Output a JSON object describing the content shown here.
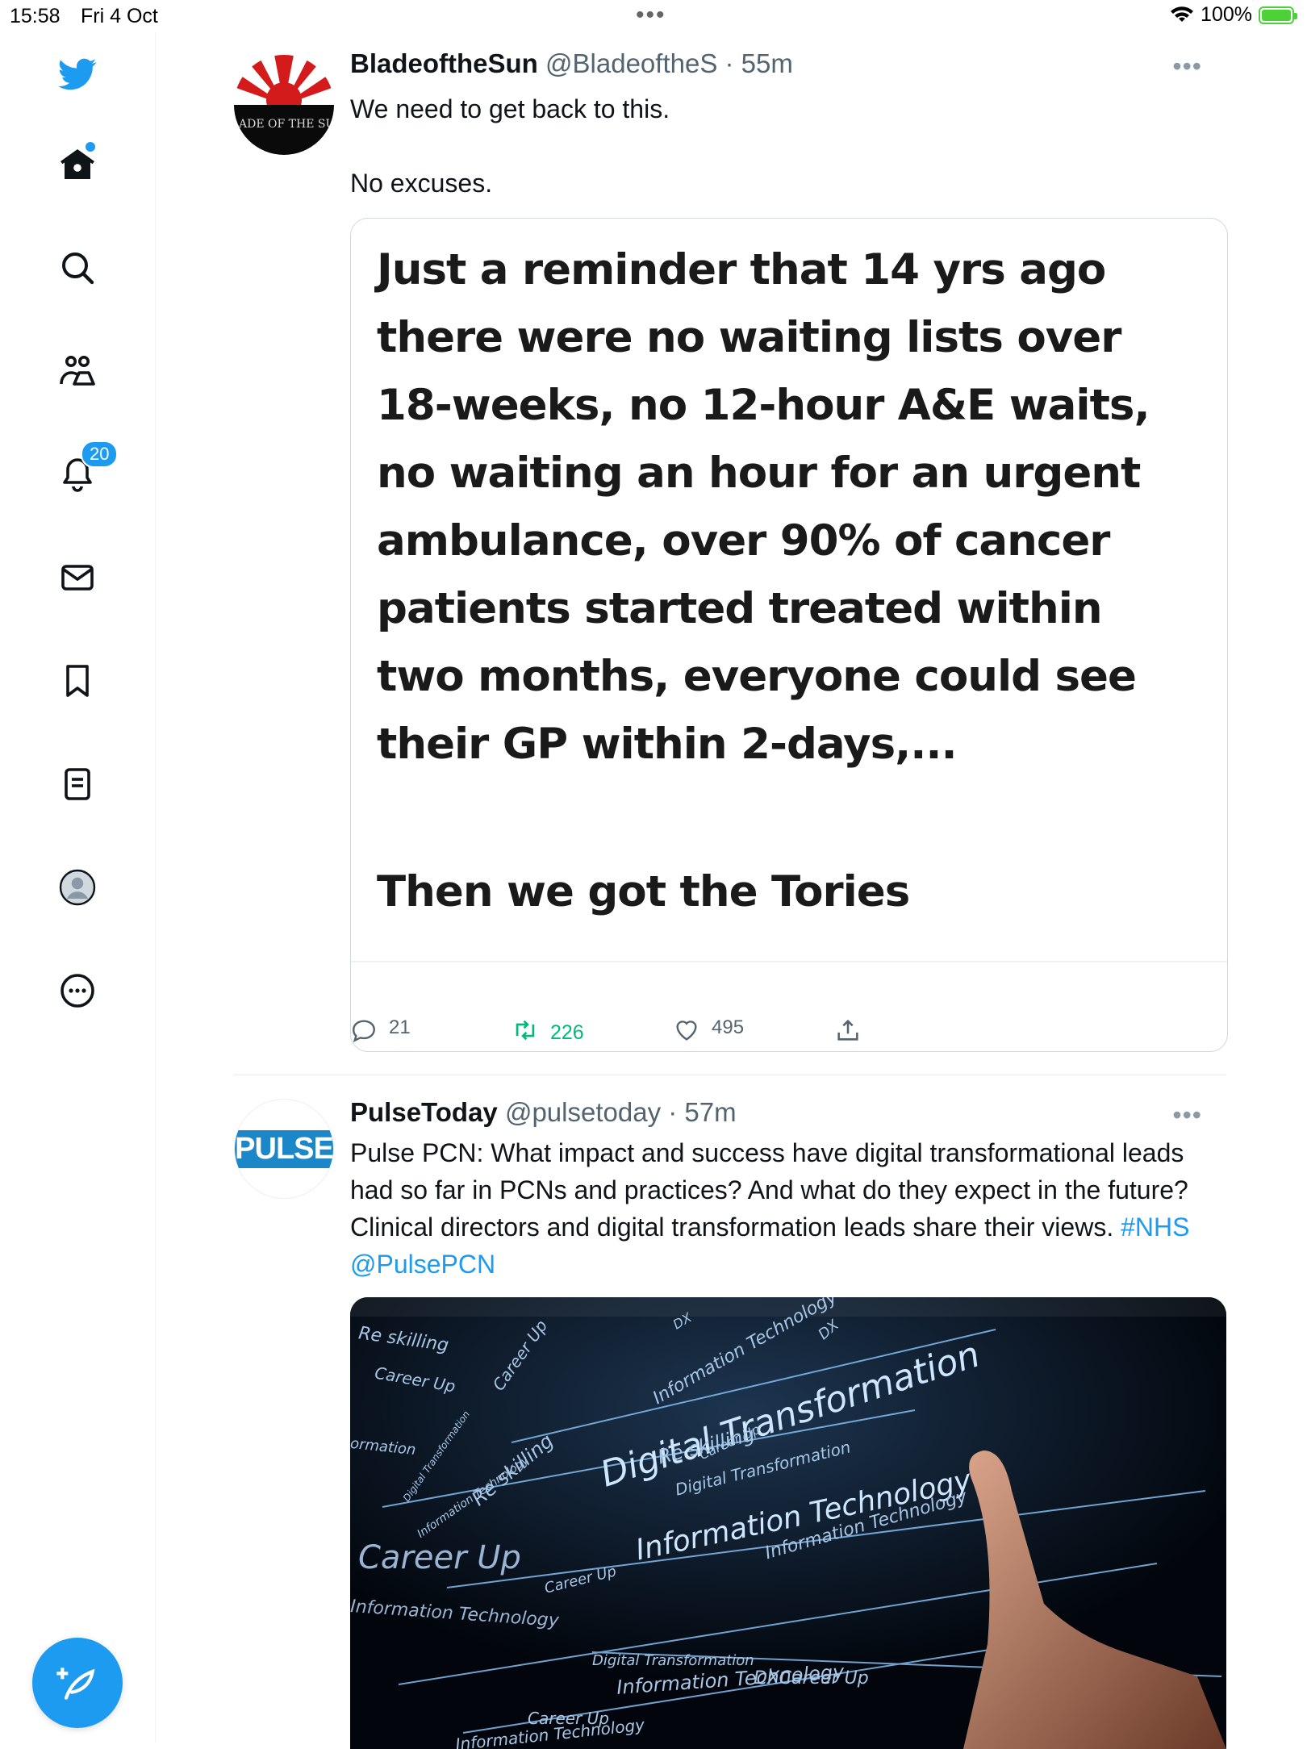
{
  "status_bar": {
    "time": "15:58",
    "date": "Fri 4 Oct",
    "battery": "100%"
  },
  "sidebar": {
    "notifications_badge": "20",
    "items": [
      {
        "name": "twitter-logo"
      },
      {
        "name": "home"
      },
      {
        "name": "explore"
      },
      {
        "name": "communities"
      },
      {
        "name": "notifications"
      },
      {
        "name": "messages"
      },
      {
        "name": "bookmarks"
      },
      {
        "name": "lists"
      },
      {
        "name": "profile"
      },
      {
        "name": "more"
      }
    ]
  },
  "tweets": [
    {
      "display_name": "BladeoftheSun",
      "handle": "@BladeoftheS",
      "time": "55m",
      "text": "We need to get back to this.\n\nNo excuses.",
      "card_text": "Just a reminder that 14 yrs ago\nthere were no waiting lists over\n18-weeks, no 12-hour A&E waits,\nno waiting an hour for an urgent\nambulance, over 90% of cancer\npatients started treated within\ntwo months, everyone could see\ntheir GP within 2-days,...",
      "card_text_2": "Then we got the Tories",
      "replies": "21",
      "retweets": "226",
      "likes": "495",
      "avatar_text": "BLADE OF THE SUN"
    },
    {
      "display_name": "PulseToday",
      "handle": "@pulsetoday",
      "time": "57m",
      "text": "Pulse PCN: What impact and success have digital transformational leads had so far in PCNs and practices?  And what do they expect in the future? Clinical directors and digital transformation leads share their views.",
      "hashtag": "#NHS",
      "mention": "@PulsePCN",
      "avatar_text": "PULSE",
      "image_words": [
        "Digital Transformation",
        "Information Technology",
        "Re skilling",
        "Career Up",
        "DX",
        "Career Up",
        "Information Technology",
        "Re skilling",
        "Digital Transformation",
        "Information Technology",
        "Career Up",
        "DX",
        "Career Up",
        "Information Technology",
        "Re skilling",
        "Digital Transformation",
        "ormation",
        "Information Technology",
        "Career Up",
        "Digital Transformation",
        "Information Technology",
        "DXCareer Up",
        "Career Up",
        "Information Technology"
      ]
    }
  ],
  "colors": {
    "accent": "#1d9bf0",
    "retweet": "#00ba7c",
    "text": "#0f1419",
    "secondary": "#536471"
  }
}
